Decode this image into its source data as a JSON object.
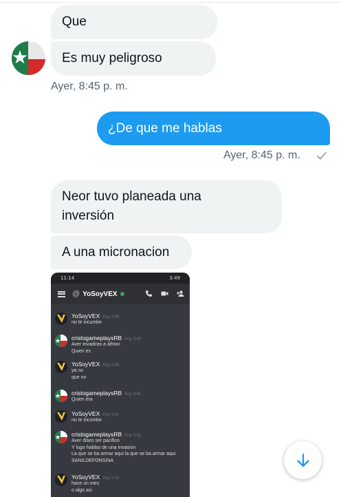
{
  "messages": [
    {
      "text": "Que"
    },
    {
      "text": "Es muy peligroso"
    },
    {
      "text": "¿De que me hablas"
    },
    {
      "text": "Neor tuvo planeada una\ninversión"
    },
    {
      "text": "A una micronacion"
    }
  ],
  "timestamps": {
    "received_1": "Ayer, 8:45 p. m.",
    "sent_1": "Ayer, 8:45 p. m."
  },
  "colors": {
    "sent_bubble": "#1d9bf0",
    "received_bubble": "#eff3f4",
    "timestamp": "#536471"
  },
  "icons": {
    "avatar": "texas-flag-avatar",
    "read_receipt": "checkmark-icon",
    "scroll_down": "arrow-down-icon"
  },
  "attachment": {
    "status_left": "11:14",
    "status_right": "3:49",
    "channel": "YoSoyVEX",
    "messages": [
      {
        "user": "YoSoyVEX",
        "time": "Hoy 3:40",
        "lines": [
          "no te incumbe"
        ],
        "avatar": "yellow"
      },
      {
        "user": "cristogameplaysRB",
        "time": "Hoy 3:40",
        "lines": [
          "Aver invadiras a alhion",
          "Quien es"
        ],
        "avatar": "flag"
      },
      {
        "user": "YoSoyVEX",
        "time": "Hoy 3:40",
        "lines": [
          "ya no",
          "que no"
        ],
        "avatar": "yellow"
      },
      {
        "user": "cristogameplaysRB",
        "time": "Hoy 3:40",
        "lines": [
          "Quien era"
        ],
        "avatar": "flag"
      },
      {
        "user": "YoSoyVEX",
        "time": "Hoy 3:41",
        "lines": [
          "no te incumbe"
        ],
        "avatar": "yellow"
      },
      {
        "user": "cristogameplaysRB",
        "time": "Hoy 3:41",
        "lines": [
          "Aver dises ser pacifico",
          "Y lugo hablas de una invasion",
          "La que se ba armar aqui la que se ba armar aqui",
          "SANILDEFONSINA"
        ],
        "avatar": "flag"
      },
      {
        "user": "YoSoyVEX",
        "time": "Hoy 3:42",
        "lines": [
          "hace un mes",
          "o algo asi"
        ],
        "avatar": "yellow"
      }
    ]
  }
}
